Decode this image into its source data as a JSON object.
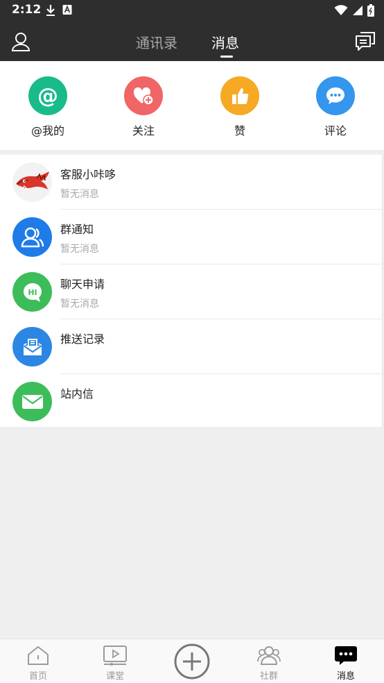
{
  "status": {
    "time": "2:12"
  },
  "header": {
    "tabs": [
      "通讯录",
      "消息"
    ],
    "active_tab": "消息"
  },
  "quick_actions": [
    {
      "label": "@我的",
      "icon": "at-icon",
      "color": "#19bb8a"
    },
    {
      "label": "关注",
      "icon": "heart-plus-icon",
      "color": "#f06565"
    },
    {
      "label": "赞",
      "icon": "thumbs-up-icon",
      "color": "#f6a924"
    },
    {
      "label": "评论",
      "icon": "comment-icon",
      "color": "#3596ee"
    }
  ],
  "messages": [
    {
      "title": "客服小咔哆",
      "subtitle": "暂无消息",
      "icon": "dragon-avatar"
    },
    {
      "title": "群通知",
      "subtitle": "暂无消息",
      "icon": "group-icon",
      "color": "#1f7be8"
    },
    {
      "title": "聊天申请",
      "subtitle": "暂无消息",
      "icon": "chat-hi-icon",
      "color": "#3dbd5a"
    },
    {
      "title": "推送记录",
      "subtitle": "",
      "icon": "inbox-icon",
      "color": "#2b87e3"
    },
    {
      "title": "站内信",
      "subtitle": "",
      "icon": "mail-icon",
      "color": "#3dbd5a"
    }
  ],
  "bottom_nav": [
    {
      "label": "首页",
      "icon": "home-icon"
    },
    {
      "label": "课堂",
      "icon": "video-icon"
    },
    {
      "label": "",
      "icon": "add-icon"
    },
    {
      "label": "社群",
      "icon": "community-icon"
    },
    {
      "label": "消息",
      "icon": "message-icon",
      "active": true
    }
  ]
}
